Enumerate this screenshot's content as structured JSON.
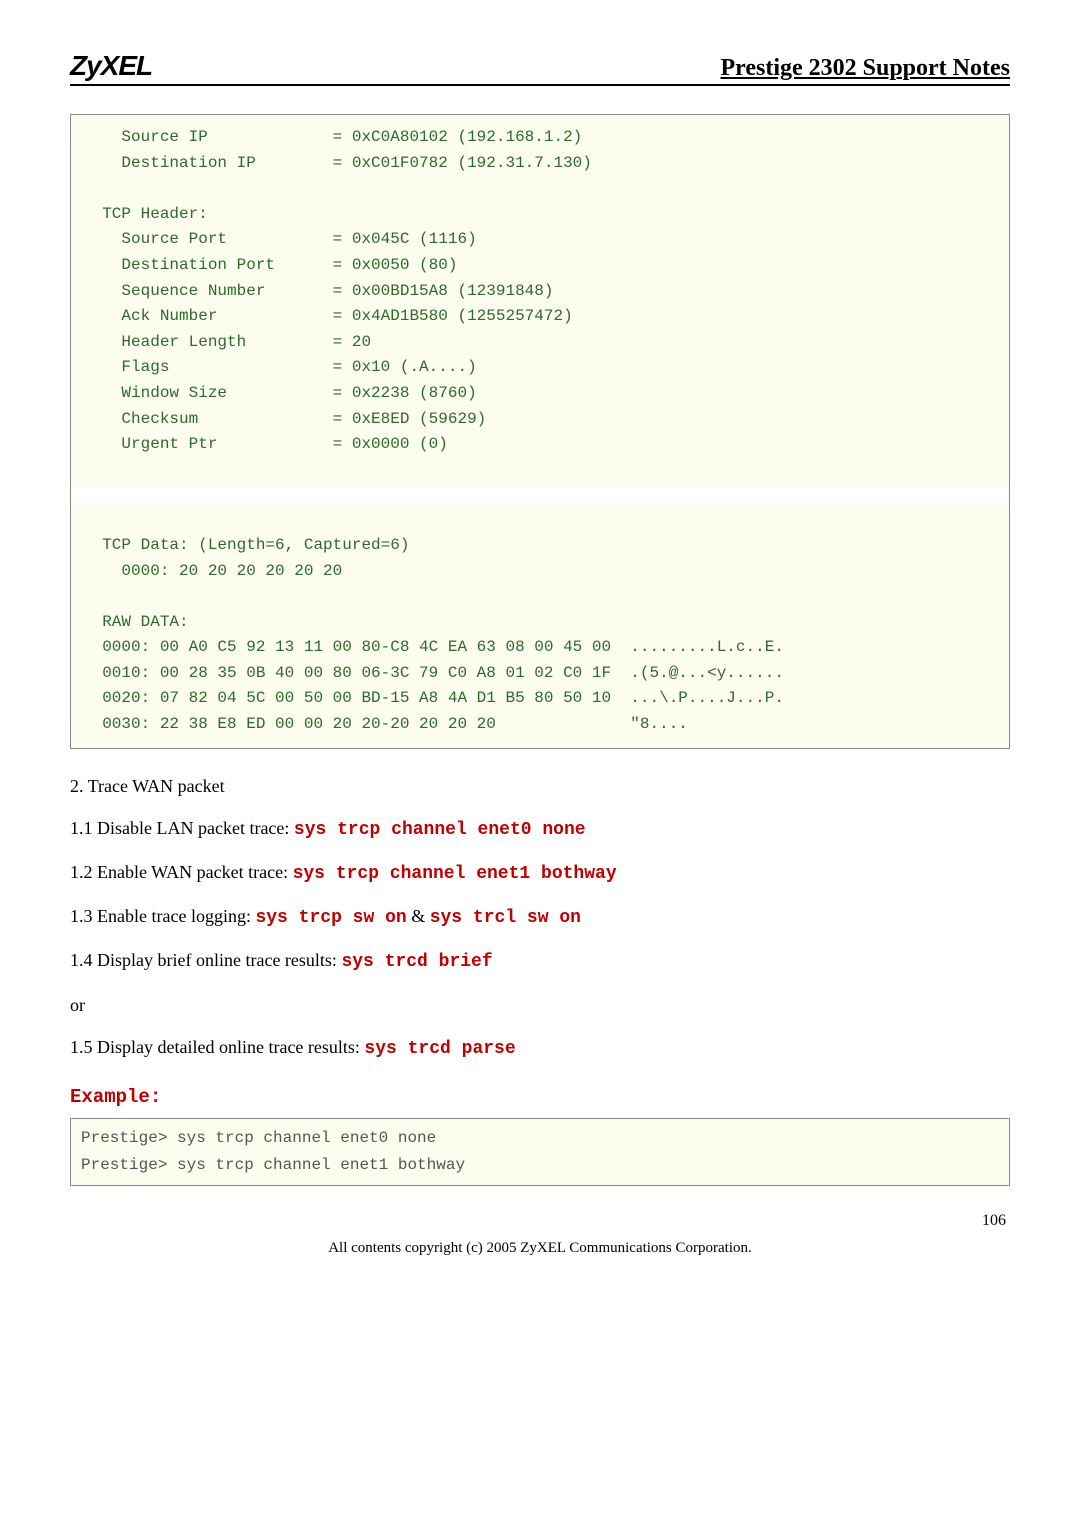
{
  "header": {
    "logo": "ZyXEL",
    "title": "Prestige 2302 Support Notes"
  },
  "codebox1": "    Source IP             = 0xC0A80102 (192.168.1.2)\n    Destination IP        = 0xC01F0782 (192.31.7.130)\n\n  TCP Header:\n    Source Port           = 0x045C (1116)\n    Destination Port      = 0x0050 (80)\n    Sequence Number       = 0x00BD15A8 (12391848)\n    Ack Number            = 0x4AD1B580 (1255257472)\n    Header Length         = 20\n    Flags                 = 0x10 (.A....)\n    Window Size           = 0x2238 (8760)\n    Checksum              = 0xE8ED (59629)\n    Urgent Ptr            = 0x0000 (0)\n",
  "codebox1b": "  TCP Data: (Length=6, Captured=6)\n    0000: 20 20 20 20 20 20\n\n  RAW DATA:\n  0000: 00 A0 C5 92 13 11 00 80-C8 4C EA 63 08 00 45 00  .........L.c..E.\n  0010: 00 28 35 0B 40 00 80 06-3C 79 C0 A8 01 02 C0 1F  .(5.@...<y......\n  0020: 07 82 04 5C 00 50 00 BD-15 A8 4A D1 B5 80 50 10  ...\\.P....J...P.\n  0030: 22 38 E8 ED 00 00 20 20-20 20 20 20              \"8....\n",
  "section2": "2. Trace WAN packet",
  "steps": {
    "s11a": "1.1 Disable LAN packet trace: ",
    "s11b": "sys trcp channel enet0 none",
    "s12a": "1.2 Enable WAN packet trace: ",
    "s12b": "sys trcp channel enet1 bothway",
    "s13a": "1.3 Enable trace logging: ",
    "s13b": "sys trcp sw on",
    "s13c": " & ",
    "s13d": "sys trcl sw on",
    "s14a": "1.4 Display brief online trace results: ",
    "s14b": "sys trcd brief",
    "or": "or",
    "s15a": "1.5 Display detailed online trace results: ",
    "s15b": "sys trcd parse"
  },
  "example_label": "Example:",
  "codebox2": "Prestige> sys trcp channel enet0 none\nPrestige> sys trcp channel enet1 bothway",
  "page_num": "106",
  "footer": "All contents copyright (c) 2005 ZyXEL Communications Corporation."
}
